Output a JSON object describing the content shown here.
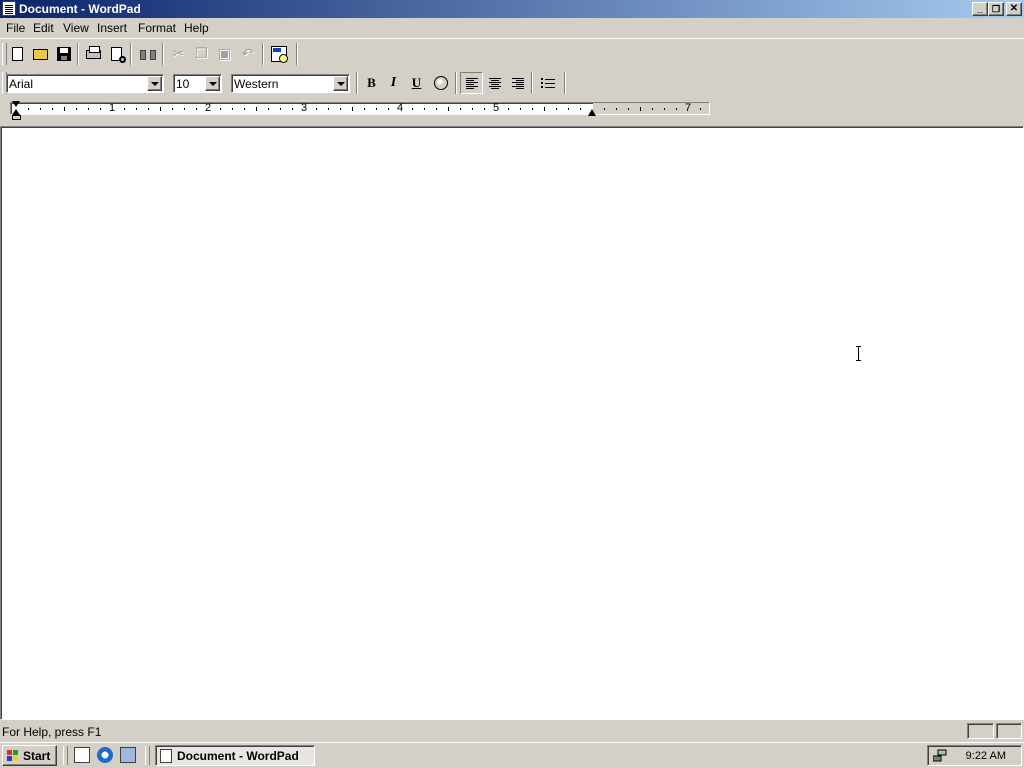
{
  "window": {
    "title": "Document - WordPad"
  },
  "menu": [
    "File",
    "Edit",
    "View",
    "Insert",
    "Format",
    "Help"
  ],
  "format_bar": {
    "font": "Arial",
    "size": "10",
    "script": "Western",
    "bold_label": "B",
    "italic_label": "I",
    "underline_label": "U"
  },
  "ruler": {
    "numbers": [
      "1",
      "2",
      "3",
      "4",
      "5",
      "7"
    ]
  },
  "document": {
    "text": ""
  },
  "status": {
    "message": "For Help, press F1"
  },
  "taskbar": {
    "start_label": "Start",
    "task_label": "Document - WordPad",
    "clock": "9:22 AM"
  },
  "colors": {
    "title_start": "#0a246a",
    "title_end": "#a6caf0",
    "face": "#d4d0c8"
  }
}
